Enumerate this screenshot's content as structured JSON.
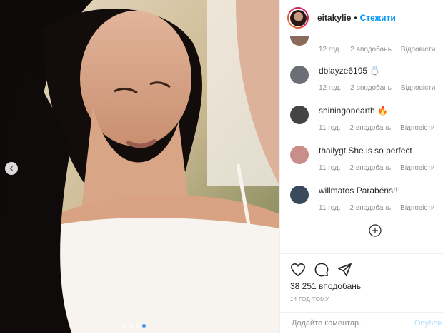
{
  "post": {
    "image_alt": "",
    "carousel": {
      "total": 4,
      "active": 3
    }
  },
  "header": {
    "username": "eitakylie",
    "separator": "•",
    "follow_label": "Стежити"
  },
  "comments": [
    {
      "username": "",
      "text": "",
      "time": "12 год.",
      "likes": "2 вподобань",
      "reply": "Відповісти",
      "avatar_color": "#8a6a5a"
    },
    {
      "username": "dblayze6195",
      "text": "",
      "emoji": "💍",
      "time": "12 год.",
      "likes": "2 вподобань",
      "reply": "Відповісти",
      "avatar_color": "#6b6f75"
    },
    {
      "username": "shiningonearth",
      "text": "",
      "emoji": "🔥",
      "time": "11 год.",
      "likes": "2 вподобань",
      "reply": "Відповісти",
      "avatar_color": "#444444"
    },
    {
      "username": "thailygt",
      "text": "She is so perfect",
      "time": "11 год.",
      "likes": "2 вподобань",
      "reply": "Відповісти",
      "avatar_color": "#c98e8a"
    },
    {
      "username": "willmatos",
      "text": "Parabéns!!!",
      "time": "11 год.",
      "likes": "2 вподобань",
      "reply": "Відповісти",
      "avatar_color": "#3a4a5c"
    }
  ],
  "stats": {
    "likes": "38 251 вподобань",
    "posted": "14 ГОД ТОМУ"
  },
  "composer": {
    "placeholder": "Додайте коментар...",
    "publish_label": "Опублік"
  },
  "colors": {
    "link": "#0095f6",
    "meta": "#8e8e8e",
    "carousel_active": "#3897f0"
  }
}
